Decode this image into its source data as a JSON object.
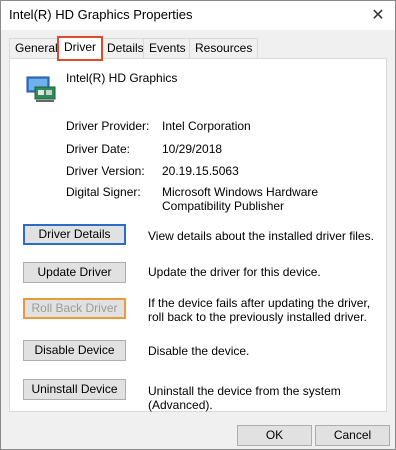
{
  "window": {
    "title": "Intel(R) HD Graphics Properties",
    "close_glyph": "✕"
  },
  "tabs": [
    {
      "label": "General"
    },
    {
      "label": "Driver"
    },
    {
      "label": "Details"
    },
    {
      "label": "Events"
    },
    {
      "label": "Resources"
    }
  ],
  "active_tab": "Driver",
  "device": {
    "name": "Intel(R) HD Graphics",
    "icon": "display-adapter-icon"
  },
  "info": [
    {
      "label": "Driver Provider:",
      "value": "Intel Corporation"
    },
    {
      "label": "Driver Date:",
      "value": "10/29/2018"
    },
    {
      "label": "Driver Version:",
      "value": "20.19.15.5063"
    },
    {
      "label": "Digital Signer:",
      "value": "Microsoft Windows Hardware Compatibility Publisher"
    }
  ],
  "actions": [
    {
      "button": "Driver Details",
      "description": "View details about the installed driver files."
    },
    {
      "button": "Update Driver",
      "description": "Update the driver for this device."
    },
    {
      "button": "Roll Back Driver",
      "description": "If the device fails after updating the driver, roll back to the previously installed driver."
    },
    {
      "button": "Disable Device",
      "description": "Disable the device."
    },
    {
      "button": "Uninstall Device",
      "description": "Uninstall the device from the system (Advanced)."
    }
  ],
  "footer": {
    "ok_label": "OK",
    "cancel_label": "Cancel"
  },
  "colors": {
    "active_tab_highlight": "#e04a2f",
    "focused_button_border": "#2b6cc4",
    "rollback_button_border": "#e89a3c"
  }
}
